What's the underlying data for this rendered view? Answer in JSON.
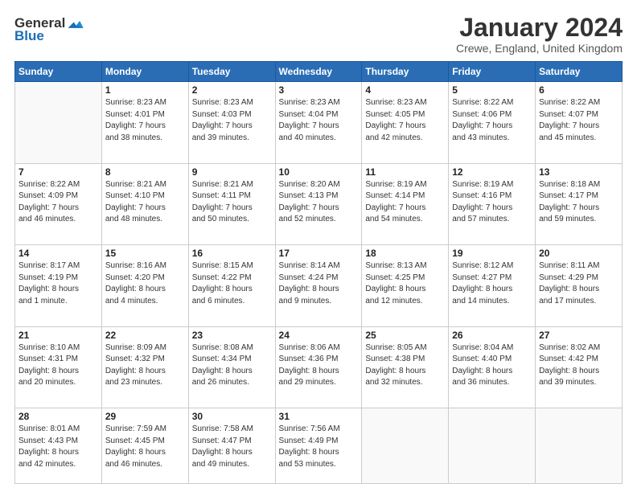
{
  "header": {
    "logo_general": "General",
    "logo_blue": "Blue",
    "month": "January 2024",
    "location": "Crewe, England, United Kingdom"
  },
  "days_of_week": [
    "Sunday",
    "Monday",
    "Tuesday",
    "Wednesday",
    "Thursday",
    "Friday",
    "Saturday"
  ],
  "weeks": [
    [
      {
        "day": "",
        "content": ""
      },
      {
        "day": "1",
        "content": "Sunrise: 8:23 AM\nSunset: 4:01 PM\nDaylight: 7 hours\nand 38 minutes."
      },
      {
        "day": "2",
        "content": "Sunrise: 8:23 AM\nSunset: 4:03 PM\nDaylight: 7 hours\nand 39 minutes."
      },
      {
        "day": "3",
        "content": "Sunrise: 8:23 AM\nSunset: 4:04 PM\nDaylight: 7 hours\nand 40 minutes."
      },
      {
        "day": "4",
        "content": "Sunrise: 8:23 AM\nSunset: 4:05 PM\nDaylight: 7 hours\nand 42 minutes."
      },
      {
        "day": "5",
        "content": "Sunrise: 8:22 AM\nSunset: 4:06 PM\nDaylight: 7 hours\nand 43 minutes."
      },
      {
        "day": "6",
        "content": "Sunrise: 8:22 AM\nSunset: 4:07 PM\nDaylight: 7 hours\nand 45 minutes."
      }
    ],
    [
      {
        "day": "7",
        "content": "Sunrise: 8:22 AM\nSunset: 4:09 PM\nDaylight: 7 hours\nand 46 minutes."
      },
      {
        "day": "8",
        "content": "Sunrise: 8:21 AM\nSunset: 4:10 PM\nDaylight: 7 hours\nand 48 minutes."
      },
      {
        "day": "9",
        "content": "Sunrise: 8:21 AM\nSunset: 4:11 PM\nDaylight: 7 hours\nand 50 minutes."
      },
      {
        "day": "10",
        "content": "Sunrise: 8:20 AM\nSunset: 4:13 PM\nDaylight: 7 hours\nand 52 minutes."
      },
      {
        "day": "11",
        "content": "Sunrise: 8:19 AM\nSunset: 4:14 PM\nDaylight: 7 hours\nand 54 minutes."
      },
      {
        "day": "12",
        "content": "Sunrise: 8:19 AM\nSunset: 4:16 PM\nDaylight: 7 hours\nand 57 minutes."
      },
      {
        "day": "13",
        "content": "Sunrise: 8:18 AM\nSunset: 4:17 PM\nDaylight: 7 hours\nand 59 minutes."
      }
    ],
    [
      {
        "day": "14",
        "content": "Sunrise: 8:17 AM\nSunset: 4:19 PM\nDaylight: 8 hours\nand 1 minute."
      },
      {
        "day": "15",
        "content": "Sunrise: 8:16 AM\nSunset: 4:20 PM\nDaylight: 8 hours\nand 4 minutes."
      },
      {
        "day": "16",
        "content": "Sunrise: 8:15 AM\nSunset: 4:22 PM\nDaylight: 8 hours\nand 6 minutes."
      },
      {
        "day": "17",
        "content": "Sunrise: 8:14 AM\nSunset: 4:24 PM\nDaylight: 8 hours\nand 9 minutes."
      },
      {
        "day": "18",
        "content": "Sunrise: 8:13 AM\nSunset: 4:25 PM\nDaylight: 8 hours\nand 12 minutes."
      },
      {
        "day": "19",
        "content": "Sunrise: 8:12 AM\nSunset: 4:27 PM\nDaylight: 8 hours\nand 14 minutes."
      },
      {
        "day": "20",
        "content": "Sunrise: 8:11 AM\nSunset: 4:29 PM\nDaylight: 8 hours\nand 17 minutes."
      }
    ],
    [
      {
        "day": "21",
        "content": "Sunrise: 8:10 AM\nSunset: 4:31 PM\nDaylight: 8 hours\nand 20 minutes."
      },
      {
        "day": "22",
        "content": "Sunrise: 8:09 AM\nSunset: 4:32 PM\nDaylight: 8 hours\nand 23 minutes."
      },
      {
        "day": "23",
        "content": "Sunrise: 8:08 AM\nSunset: 4:34 PM\nDaylight: 8 hours\nand 26 minutes."
      },
      {
        "day": "24",
        "content": "Sunrise: 8:06 AM\nSunset: 4:36 PM\nDaylight: 8 hours\nand 29 minutes."
      },
      {
        "day": "25",
        "content": "Sunrise: 8:05 AM\nSunset: 4:38 PM\nDaylight: 8 hours\nand 32 minutes."
      },
      {
        "day": "26",
        "content": "Sunrise: 8:04 AM\nSunset: 4:40 PM\nDaylight: 8 hours\nand 36 minutes."
      },
      {
        "day": "27",
        "content": "Sunrise: 8:02 AM\nSunset: 4:42 PM\nDaylight: 8 hours\nand 39 minutes."
      }
    ],
    [
      {
        "day": "28",
        "content": "Sunrise: 8:01 AM\nSunset: 4:43 PM\nDaylight: 8 hours\nand 42 minutes."
      },
      {
        "day": "29",
        "content": "Sunrise: 7:59 AM\nSunset: 4:45 PM\nDaylight: 8 hours\nand 46 minutes."
      },
      {
        "day": "30",
        "content": "Sunrise: 7:58 AM\nSunset: 4:47 PM\nDaylight: 8 hours\nand 49 minutes."
      },
      {
        "day": "31",
        "content": "Sunrise: 7:56 AM\nSunset: 4:49 PM\nDaylight: 8 hours\nand 53 minutes."
      },
      {
        "day": "",
        "content": ""
      },
      {
        "day": "",
        "content": ""
      },
      {
        "day": "",
        "content": ""
      }
    ]
  ]
}
